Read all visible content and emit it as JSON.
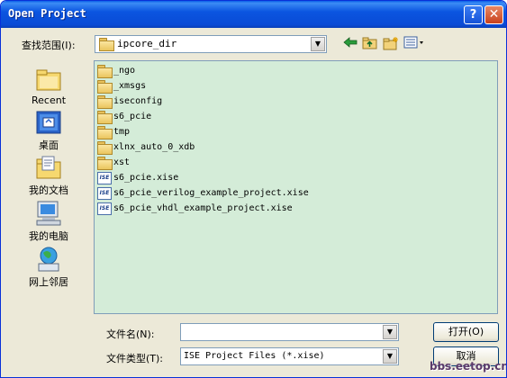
{
  "window": {
    "title": "Open Project",
    "help_label": "?",
    "close_label": "✕"
  },
  "lookin": {
    "label": "查找范围(I):",
    "value": "ipcore_dir"
  },
  "toolbar": {
    "back_icon": "back-arrow-icon",
    "up_icon": "up-folder-icon",
    "newfolder_icon": "new-folder-icon",
    "views_icon": "views-menu-icon"
  },
  "places": [
    {
      "label": "Recent"
    },
    {
      "label": "桌面"
    },
    {
      "label": "我的文档"
    },
    {
      "label": "我的电脑"
    },
    {
      "label": "网上邻居"
    }
  ],
  "files": [
    {
      "name": "_ngo",
      "kind": "folder"
    },
    {
      "name": "_xmsgs",
      "kind": "folder"
    },
    {
      "name": "iseconfig",
      "kind": "folder"
    },
    {
      "name": "s6_pcie",
      "kind": "folder"
    },
    {
      "name": "tmp",
      "kind": "folder"
    },
    {
      "name": "xlnx_auto_0_xdb",
      "kind": "folder"
    },
    {
      "name": "xst",
      "kind": "folder"
    },
    {
      "name": "s6_pcie.xise",
      "kind": "xise"
    },
    {
      "name": "s6_pcie_verilog_example_project.xise",
      "kind": "xise"
    },
    {
      "name": "s6_pcie_vhdl_example_project.xise",
      "kind": "xise"
    }
  ],
  "filename": {
    "label": "文件名(N):",
    "value": ""
  },
  "filetype": {
    "label": "文件类型(T):",
    "value": "ISE Project Files (*.xise)"
  },
  "buttons": {
    "open": "打开(O)",
    "cancel": "取消"
  },
  "watermark": "bbs.eetop.cn",
  "colors": {
    "titlebar": "#0b55e0",
    "list_background": "#d4ecd8",
    "dialog_background": "#ece9d8"
  }
}
